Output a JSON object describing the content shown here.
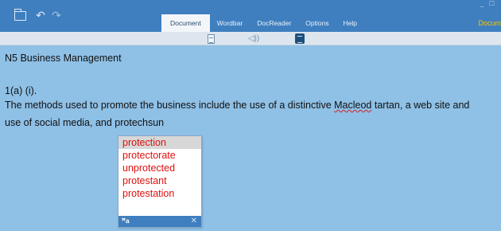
{
  "app": {
    "menu": [
      "Document",
      "Wordbar",
      "DocReader",
      "Options",
      "Help"
    ],
    "active_menu_index": 0,
    "right_edge_text": "Docum",
    "window_controls": "_ ☐"
  },
  "toolbar": {
    "icons": [
      "document-icon",
      "speaker-icon",
      "list-icon"
    ]
  },
  "document": {
    "lines": [
      "N5 Business Management",
      "1(a) (i).",
      "The methods used to promote the business include the use of a distinctive ",
      "use of social media, and protechsun"
    ],
    "line3_word": "Macleod",
    "line3_tail": " tartan, a web site and"
  },
  "popup": {
    "suggestions": [
      "protection",
      "protectorate",
      "unprotected",
      "protestant",
      "protestation"
    ],
    "selected_index": 0,
    "footer_icon": "wordbar-icon",
    "close_label": "✕"
  },
  "colors": {
    "titlebar": "#3f7fbf",
    "background": "#8fc0e6",
    "suggestion_text": "#e01010"
  }
}
